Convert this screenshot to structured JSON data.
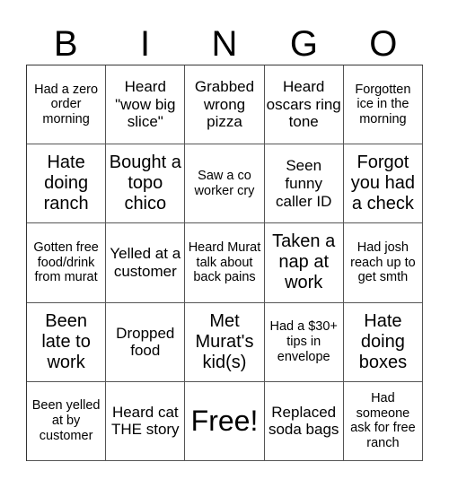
{
  "header": [
    "B",
    "I",
    "N",
    "G",
    "O"
  ],
  "cells": [
    {
      "text": "Had a zero order morning",
      "size": "s"
    },
    {
      "text": "Heard \"wow big slice\"",
      "size": "m"
    },
    {
      "text": "Grabbed wrong pizza",
      "size": "m"
    },
    {
      "text": "Heard oscars ring tone",
      "size": "m"
    },
    {
      "text": "Forgotten ice in the morning",
      "size": "s"
    },
    {
      "text": "Hate doing ranch",
      "size": "l"
    },
    {
      "text": "Bought a topo chico",
      "size": "l"
    },
    {
      "text": "Saw a co worker cry",
      "size": "s"
    },
    {
      "text": "Seen funny caller ID",
      "size": "m"
    },
    {
      "text": "Forgot you had a check",
      "size": "l"
    },
    {
      "text": "Gotten free food/drink from murat",
      "size": "s"
    },
    {
      "text": "Yelled at a customer",
      "size": "m"
    },
    {
      "text": "Heard Murat talk about back pains",
      "size": "s"
    },
    {
      "text": "Taken a nap at work",
      "size": "l"
    },
    {
      "text": "Had josh reach up to get smth",
      "size": "s"
    },
    {
      "text": "Been late to work",
      "size": "l"
    },
    {
      "text": "Dropped food",
      "size": "m"
    },
    {
      "text": "Met Murat's kid(s)",
      "size": "l"
    },
    {
      "text": "Had a $30+ tips in envelope",
      "size": "s"
    },
    {
      "text": "Hate doing boxes",
      "size": "l"
    },
    {
      "text": "Been yelled at by customer",
      "size": "s"
    },
    {
      "text": "Heard cat THE story",
      "size": "m"
    },
    {
      "text": "Free!",
      "size": "free"
    },
    {
      "text": "Replaced soda bags",
      "size": "m"
    },
    {
      "text": "Had someone ask for free ranch",
      "size": "s"
    }
  ]
}
